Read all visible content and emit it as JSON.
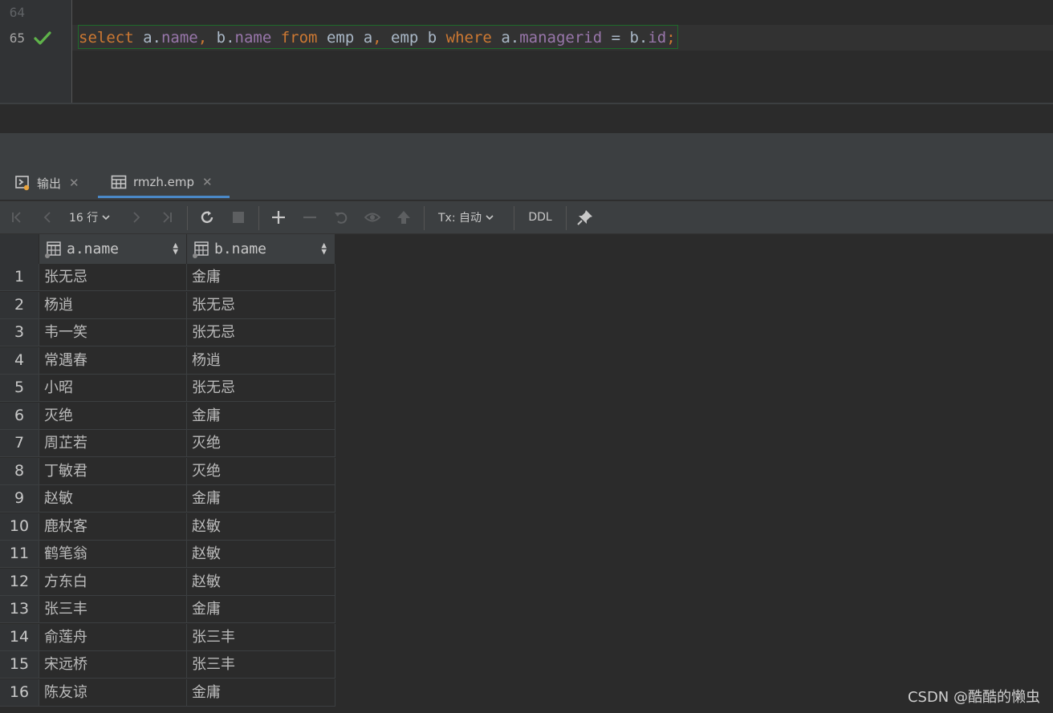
{
  "editor": {
    "prev_line_number": "64",
    "line_number": "65",
    "code_tokens": [
      {
        "t": "select",
        "c": "kw"
      },
      {
        "t": " a.",
        "c": "pl"
      },
      {
        "t": "name",
        "c": "fld"
      },
      {
        "t": ",",
        "c": "kw"
      },
      {
        "t": " b.",
        "c": "pl"
      },
      {
        "t": "name",
        "c": "fld"
      },
      {
        "t": " ",
        "c": "pl"
      },
      {
        "t": "from",
        "c": "kw"
      },
      {
        "t": " emp a",
        "c": "pl"
      },
      {
        "t": ",",
        "c": "kw"
      },
      {
        "t": " emp b ",
        "c": "pl"
      },
      {
        "t": "where",
        "c": "kw"
      },
      {
        "t": " a.",
        "c": "pl"
      },
      {
        "t": "managerid",
        "c": "fld"
      },
      {
        "t": " = b.",
        "c": "pl"
      },
      {
        "t": "id",
        "c": "fld"
      },
      {
        "t": ";",
        "c": "kw"
      }
    ]
  },
  "tabs": {
    "output_label": "输出",
    "emp_label": "rmzh.emp"
  },
  "toolbar": {
    "rows_label": "16 行",
    "tx_label": "Tx: 自动",
    "ddl_label": "DDL"
  },
  "grid": {
    "columns": [
      "a.name",
      "b.name"
    ],
    "rows": [
      {
        "n": "1",
        "a": "张无忌",
        "b": "金庸"
      },
      {
        "n": "2",
        "a": "杨逍",
        "b": "张无忌"
      },
      {
        "n": "3",
        "a": "韦一笑",
        "b": "张无忌"
      },
      {
        "n": "4",
        "a": "常遇春",
        "b": "杨逍"
      },
      {
        "n": "5",
        "a": "小昭",
        "b": "张无忌"
      },
      {
        "n": "6",
        "a": "灭绝",
        "b": "金庸"
      },
      {
        "n": "7",
        "a": "周芷若",
        "b": "灭绝"
      },
      {
        "n": "8",
        "a": "丁敏君",
        "b": "灭绝"
      },
      {
        "n": "9",
        "a": "赵敏",
        "b": "金庸"
      },
      {
        "n": "10",
        "a": "鹿杖客",
        "b": "赵敏"
      },
      {
        "n": "11",
        "a": "鹤笔翁",
        "b": "赵敏"
      },
      {
        "n": "12",
        "a": "方东白",
        "b": "赵敏"
      },
      {
        "n": "13",
        "a": "张三丰",
        "b": "金庸"
      },
      {
        "n": "14",
        "a": "俞莲舟",
        "b": "张三丰"
      },
      {
        "n": "15",
        "a": "宋远桥",
        "b": "张三丰"
      },
      {
        "n": "16",
        "a": "陈友谅",
        "b": "金庸"
      }
    ]
  },
  "watermark": "CSDN @酷酷的懒虫",
  "colors": {
    "keyword": "#cc7832",
    "field": "#9876aa",
    "plain": "#a9b7c6",
    "success_check": "#5fb34a",
    "tab_underline": "#4a88c7"
  }
}
